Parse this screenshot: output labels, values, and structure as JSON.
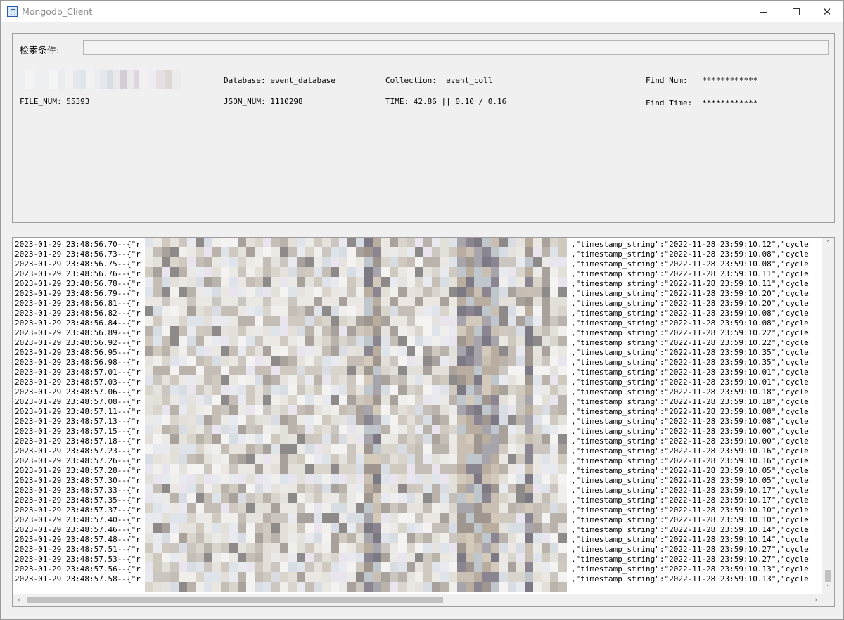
{
  "window": {
    "title": "Mongodb_Client",
    "minimize_label": "",
    "maximize_label": "",
    "close_label": "✕"
  },
  "search": {
    "label": "检索条件:",
    "value": ""
  },
  "info": {
    "database": "Database: event_database",
    "collection": "Collection:  event_coll",
    "find_num_label": "Find Num:",
    "find_num_value": "************",
    "file_num": "FILE_NUM: 55393",
    "json_num": "JSON_NUM: 1110298",
    "time": "TIME: 42.86 || 0.10 / 0.16",
    "find_time_label": "Find Time:",
    "find_time_value": "************"
  },
  "log": {
    "lines": [
      {
        "ts": "2023-01-29 23:48:56.70--{\"r",
        "tail": ",\"timestamp_string\":\"2022-11-28 23:59:10.12\",\"cycle"
      },
      {
        "ts": "2023-01-29 23:48:56.73--{\"r",
        "tail": ",\"timestamp_string\":\"2022-11-28 23:59:10.08\",\"cycle"
      },
      {
        "ts": "2023-01-29 23:48:56.75--{\"r",
        "tail": ",\"timestamp_string\":\"2022-11-28 23:59:10.08\",\"cycle"
      },
      {
        "ts": "2023-01-29 23:48:56.76--{\"r",
        "tail": ",\"timestamp_string\":\"2022-11-28 23:59:10.11\",\"cycle"
      },
      {
        "ts": "2023-01-29 23:48:56.78--{\"r",
        "tail": ",\"timestamp_string\":\"2022-11-28 23:59:10.11\",\"cycle"
      },
      {
        "ts": "2023-01-29 23:48:56.79--{\"r",
        "tail": ",\"timestamp_string\":\"2022-11-28 23:59:10.20\",\"cycle"
      },
      {
        "ts": "2023-01-29 23:48:56.81--{\"r",
        "tail": ",\"timestamp_string\":\"2022-11-28 23:59:10.20\",\"cycle"
      },
      {
        "ts": "2023-01-29 23:48:56.82--{\"r",
        "tail": ",\"timestamp_string\":\"2022-11-28 23:59:10.08\",\"cycle"
      },
      {
        "ts": "2023-01-29 23:48:56.84--{\"r",
        "tail": ",\"timestamp_string\":\"2022-11-28 23:59:10.08\",\"cycle"
      },
      {
        "ts": "2023-01-29 23:48:56.89--{\"r",
        "tail": ",\"timestamp_string\":\"2022-11-28 23:59:10.22\",\"cycle"
      },
      {
        "ts": "2023-01-29 23:48:56.92--{\"r",
        "tail": ",\"timestamp_string\":\"2022-11-28 23:59:10.22\",\"cycle"
      },
      {
        "ts": "2023-01-29 23:48:56.95--{\"r",
        "tail": ",\"timestamp_string\":\"2022-11-28 23:59:10.35\",\"cycle"
      },
      {
        "ts": "2023-01-29 23:48:56.98--{\"r",
        "tail": ",\"timestamp_string\":\"2022-11-28 23:59:10.35\",\"cycle"
      },
      {
        "ts": "2023-01-29 23:48:57.01--{\"r",
        "tail": ",\"timestamp_string\":\"2022-11-28 23:59:10.01\",\"cycle"
      },
      {
        "ts": "2023-01-29 23:48:57.03--{\"r",
        "tail": ",\"timestamp_string\":\"2022-11-28 23:59:10.01\",\"cycle"
      },
      {
        "ts": "2023-01-29 23:48:57.06--{\"r",
        "tail": ",\"timestamp_string\":\"2022-11-28 23:59:10.18\",\"cycle"
      },
      {
        "ts": "2023-01-29 23:48:57.08--{\"r",
        "tail": ",\"timestamp_string\":\"2022-11-28 23:59:10.18\",\"cycle"
      },
      {
        "ts": "2023-01-29 23:48:57.11--{\"r",
        "tail": ",\"timestamp_string\":\"2022-11-28 23:59:10.08\",\"cycle"
      },
      {
        "ts": "2023-01-29 23:48:57.13--{\"r",
        "tail": ",\"timestamp_string\":\"2022-11-28 23:59:10.08\",\"cycle"
      },
      {
        "ts": "2023-01-29 23:48:57.15--{\"r",
        "tail": ",\"timestamp_string\":\"2022-11-28 23:59:10.00\",\"cycle"
      },
      {
        "ts": "2023-01-29 23:48:57.18--{\"r",
        "tail": ",\"timestamp_string\":\"2022-11-28 23:59:10.00\",\"cycle"
      },
      {
        "ts": "2023-01-29 23:48:57.23--{\"r",
        "tail": ",\"timestamp_string\":\"2022-11-28 23:59:10.16\",\"cycle"
      },
      {
        "ts": "2023-01-29 23:48:57.26--{\"r",
        "tail": ",\"timestamp_string\":\"2022-11-28 23:59:10.16\",\"cycle"
      },
      {
        "ts": "2023-01-29 23:48:57.28--{\"r",
        "tail": ",\"timestamp_string\":\"2022-11-28 23:59:10.05\",\"cycle"
      },
      {
        "ts": "2023-01-29 23:48:57.30--{\"r",
        "tail": ",\"timestamp_string\":\"2022-11-28 23:59:10.05\",\"cycle"
      },
      {
        "ts": "2023-01-29 23:48:57.33--{\"r",
        "tail": ",\"timestamp_string\":\"2022-11-28 23:59:10.17\",\"cycle"
      },
      {
        "ts": "2023-01-29 23:48:57.35--{\"r",
        "tail": ",\"timestamp_string\":\"2022-11-28 23:59:10.17\",\"cycle"
      },
      {
        "ts": "2023-01-29 23:48:57.37--{\"r",
        "tail": ",\"timestamp_string\":\"2022-11-28 23:59:10.10\",\"cycle"
      },
      {
        "ts": "2023-01-29 23:48:57.40--{\"r",
        "tail": ",\"timestamp_string\":\"2022-11-28 23:59:10.10\",\"cycle"
      },
      {
        "ts": "2023-01-29 23:48:57.46--{\"r",
        "tail": ",\"timestamp_string\":\"2022-11-28 23:59:10.14\",\"cycle"
      },
      {
        "ts": "2023-01-29 23:48:57.48--{\"r",
        "tail": ",\"timestamp_string\":\"2022-11-28 23:59:10.14\",\"cycle"
      },
      {
        "ts": "2023-01-29 23:48:57.51--{\"r",
        "tail": ",\"timestamp_string\":\"2022-11-28 23:59:10.27\",\"cycle"
      },
      {
        "ts": "2023-01-29 23:48:57.53--{\"r",
        "tail": ",\"timestamp_string\":\"2022-11-28 23:59:10.27\",\"cycle"
      },
      {
        "ts": "2023-01-29 23:48:57.56--{\"r",
        "tail": ",\"timestamp_string\":\"2022-11-28 23:59:10.13\",\"cycle"
      },
      {
        "ts": "2023-01-29 23:48:57.58--{\"r",
        "tail": ",\"timestamp_string\":\"2022-11-28 23:59:10.13\",\"cycle"
      }
    ]
  },
  "scrollbars": {
    "up_arrow": "˄",
    "down_arrow": "˅",
    "left_arrow": "‹",
    "right_arrow": "›"
  },
  "icons": {
    "app": "window-app-icon",
    "minimize": "minimize-icon",
    "maximize": "maximize-icon",
    "close": "close-icon"
  }
}
